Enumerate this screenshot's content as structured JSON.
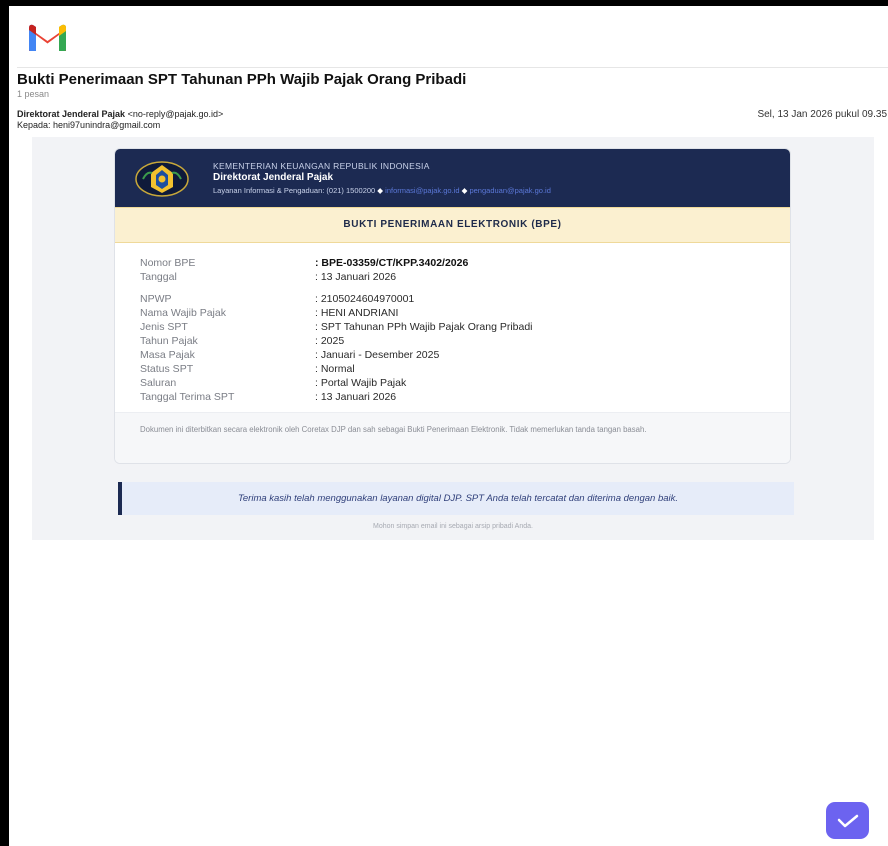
{
  "email": {
    "subject": "Bukti Penerimaan SPT Tahunan PPh Wajib Pajak Orang Pribadi",
    "message_count": "1 pesan",
    "sender_name": "Direktorat Jenderal Pajak",
    "sender_email": "<no-reply@pajak.go.id>",
    "recipient": "Kepada: heni97unindra@gmail.com",
    "date": "Sel, 13 Jan 2026 pukul 09.35"
  },
  "letterhead": {
    "ministry": "KEMENTERIAN KEUANGAN REPUBLIK INDONESIA",
    "org_name": "Direktorat Jenderal Pajak",
    "contact_label": "Layanan Informasi & Pengaduan: (021) 1500200",
    "email_info": "informasi@pajak.go.id",
    "email_complaint": "pengaduan@pajak.go.id",
    "separator": "◆"
  },
  "bpe": {
    "title": "BUKTI PENERIMAAN ELEKTRONIK (BPE)",
    "rows": [
      {
        "label": "Nomor BPE",
        "value": ": BPE-03359/CT/KPP.3402/2026"
      },
      {
        "label": "Tanggal",
        "value": ": 13 Januari 2026"
      },
      {
        "label": "NPWP",
        "value": ": 2105024604970001"
      },
      {
        "label": "Nama Wajib Pajak",
        "value": ": HENI ANDRIANI"
      },
      {
        "label": "Jenis SPT",
        "value": ": SPT Tahunan PPh Wajib Pajak Orang Pribadi"
      },
      {
        "label": "Tahun Pajak",
        "value": ": 2025"
      },
      {
        "label": "Masa Pajak",
        "value": ": Januari - Desember 2025"
      },
      {
        "label": "Status SPT",
        "value": ": Normal"
      },
      {
        "label": "Saluran",
        "value": ": Portal Wajib Pajak"
      },
      {
        "label": "Tanggal Terima SPT",
        "value": ": 13 Januari 2026"
      }
    ],
    "footer_note": "Dokumen ini diterbitkan secara elektronik oleh Coretax DJP dan sah sebagai Bukti Penerimaan Elektronik. Tidak memerlukan tanda tangan basah."
  },
  "thanks": "Terima kasih telah menggunakan layanan digital DJP. SPT Anda telah tercatat dan diterima dengan baik.",
  "archive_note": "Mohon simpan email ini sebagai arsip pribadi Anda.",
  "colors": {
    "header_navy": "#1c2a52",
    "bpe_bar": "#fbf0d0",
    "check_button": "#6c63f0"
  }
}
